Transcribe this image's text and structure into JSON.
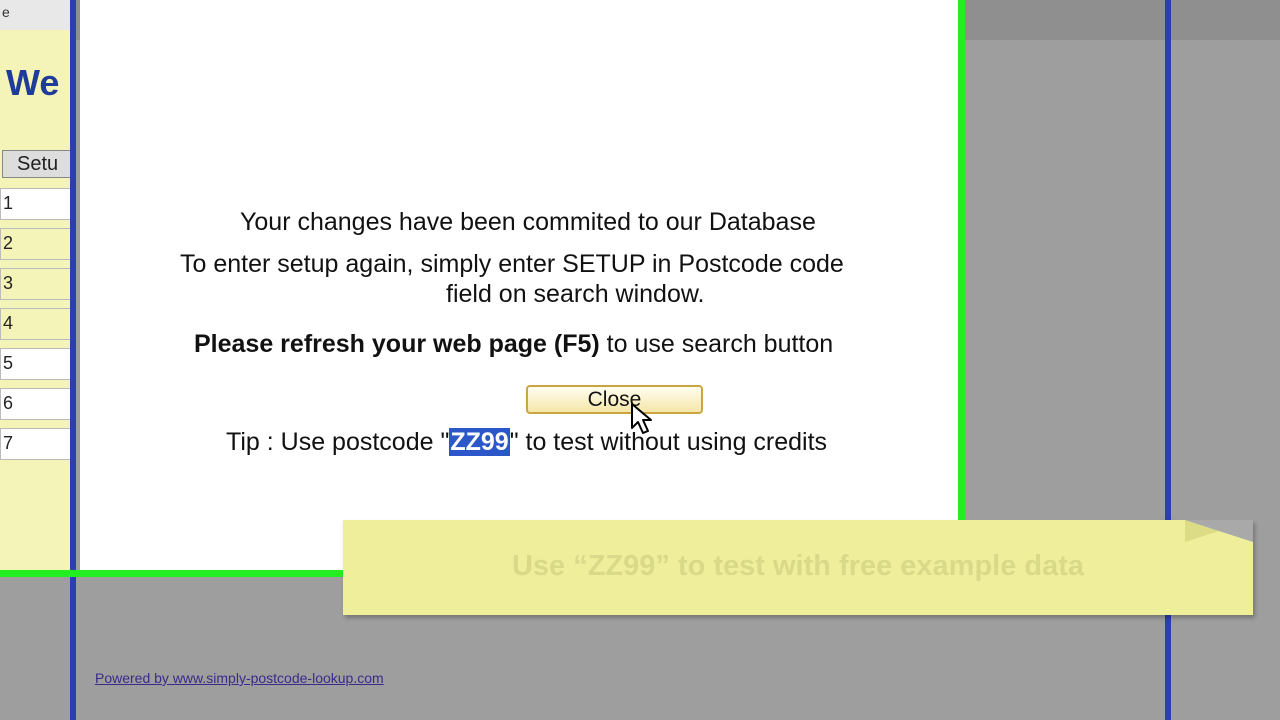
{
  "background": {
    "left_tab_label": "e",
    "heading": "We",
    "setup_button": "Setu",
    "rows": [
      "1",
      "2",
      "3",
      "4",
      "5",
      "6",
      "7"
    ],
    "powered_by": "Powered by www.simply-postcode-lookup.com"
  },
  "dialog": {
    "line1": "Your changes have been commited to our Database",
    "line2": "To enter setup again, simply enter SETUP in Postcode code",
    "line3": "field on search window.",
    "refresh_bold": "Please refresh your web page (F5)",
    "refresh_rest": " to use search button",
    "close_label": "Close",
    "tip_prefix": "Tip : Use postcode \"",
    "tip_code": "ZZ99",
    "tip_suffix": "\" to test without using credits"
  },
  "note": {
    "text": "Use “ZZ99” to test with free example data"
  },
  "colors": {
    "green_border": "#22ee22",
    "blue_border": "#2a3fb0",
    "note_background": "#efee9a",
    "button_border": "#c9a642",
    "selection": "#2b57c9"
  },
  "icons": {
    "cursor": "arrow-pointer-icon"
  }
}
